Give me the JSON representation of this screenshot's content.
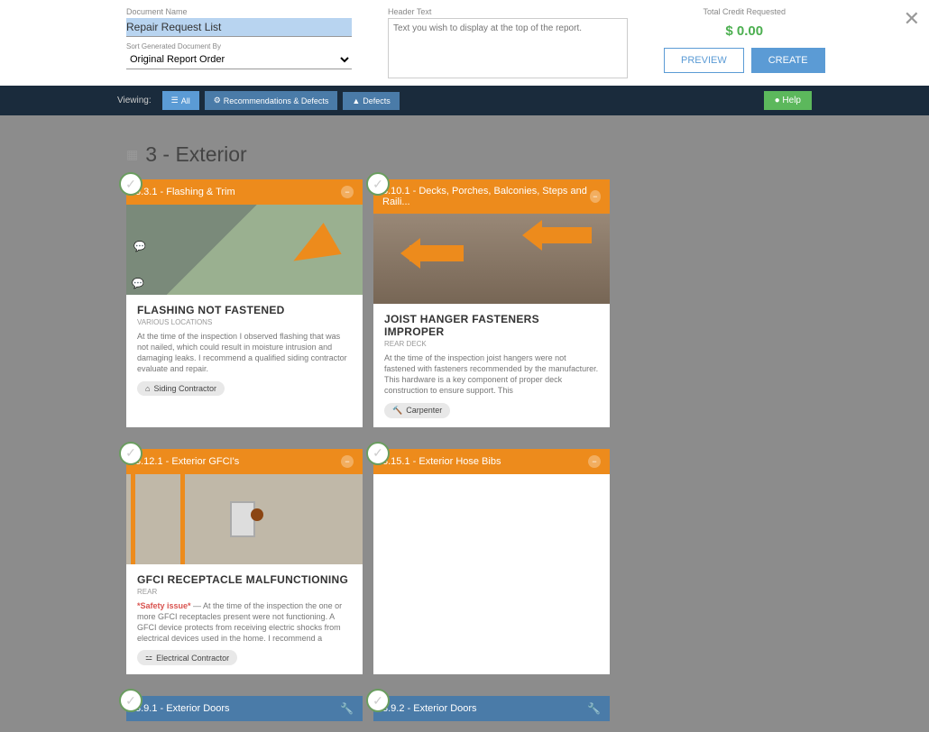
{
  "form": {
    "doc_name_label": "Document Name",
    "doc_name_value": "Repair Request List",
    "sort_label": "Sort Generated Document By",
    "sort_value": "Original Report Order",
    "header_label": "Header Text",
    "header_placeholder": "Text you wish to display at the top of the report.",
    "credit_label": "Total Credit Requested",
    "credit_value": "$ 0.00",
    "preview": "PREVIEW",
    "create": "CREATE"
  },
  "viewbar": {
    "label": "Viewing:",
    "all": "All",
    "recs": "Recommendations & Defects",
    "defects": "Defects",
    "help": "Help"
  },
  "section": {
    "title": "3 - Exterior"
  },
  "cards": [
    {
      "header": "3.3.1 - Flashing & Trim",
      "style": "orange",
      "action_icon": "minus",
      "title": "FLASHING NOT FASTENED",
      "sub": "VARIOUS LOCATIONS",
      "text": "At the time of the inspection I observed flashing that was not nailed, which could result in moisture intrusion and damaging leaks. I recommend a qualified siding contractor evaluate and repair.",
      "tag": "Siding Contractor",
      "tag_icon": "house"
    },
    {
      "header": "3.10.1 - Decks, Porches, Balconies, Steps and Raili...",
      "style": "orange",
      "action_icon": "minus",
      "title": "JOIST HANGER FASTENERS IMPROPER",
      "sub": "REAR DECK",
      "text": "At the time of the inspection joist hangers were not fastened with fasteners recommended by the manufacturer. This hardware is a key component of proper deck construction to ensure support. This",
      "tag": "Carpenter",
      "tag_icon": "hammer"
    },
    {
      "header": "3.12.1 - Exterior GFCI's",
      "style": "orange",
      "action_icon": "minus",
      "title": "GFCI RECEPTACLE MALFUNCTIONING",
      "sub": "REAR",
      "safety": "*Safety issue*",
      "text": " — At the time of the inspection the  one or more GFCI receptacles present were not functioning. A GFCI device protects from receiving electric shocks from electrical devices used in the home. I recommend a",
      "tag": "Electrical Contractor",
      "tag_icon": "outlet"
    },
    {
      "header": "3.15.1 - Exterior Hose Bibs",
      "style": "orange",
      "action_icon": "minus"
    },
    {
      "header": "3.9.1 - Exterior Doors",
      "style": "blue",
      "action_icon": "wrench"
    },
    {
      "header": "3.9.2 - Exterior Doors",
      "style": "blue",
      "action_icon": "wrench"
    }
  ]
}
